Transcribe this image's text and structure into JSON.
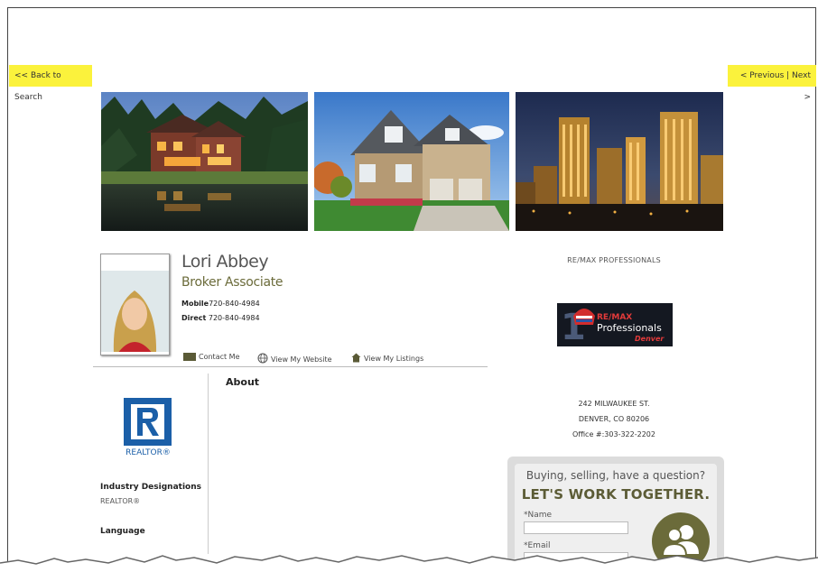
{
  "nav": {
    "back_label": "<< Back to Search",
    "previous_label": "< Previous",
    "separator": " | ",
    "next_label": "Next >"
  },
  "agent": {
    "name": "Lori Abbey",
    "title": "Broker Associate",
    "mobile_label": "Mobile",
    "mobile": "720-840-4984",
    "direct_label": "Direct",
    "direct": "720-840-4984"
  },
  "links": {
    "contact": "Contact Me",
    "website": "View My Website",
    "listings": "View My Listings"
  },
  "about": {
    "heading": "About"
  },
  "realtor": {
    "logo_text": "REALTOR®"
  },
  "designations": {
    "heading": "Industry Designations",
    "value": "REALTOR®"
  },
  "language": {
    "heading": "Language"
  },
  "brokerage": {
    "name": "RE/MAX PROFESSIONALS",
    "logo_line1": "RE/MAX",
    "logo_line2": "Professionals",
    "logo_line3": "Denver",
    "address_line1": "242 MILWAUKEE ST.",
    "address_line2": "DENVER, CO 80206",
    "office": "Office #:303-322-2202"
  },
  "contact_form": {
    "question": "Buying, selling, have a question?",
    "headline": "LET'S WORK TOGETHER.",
    "name_label": "*Name",
    "email_label": "*Email"
  },
  "colors": {
    "nav_yellow": "#fbf23c",
    "olive": "#6b6b3a",
    "realtor_blue": "#1b5fa8"
  }
}
